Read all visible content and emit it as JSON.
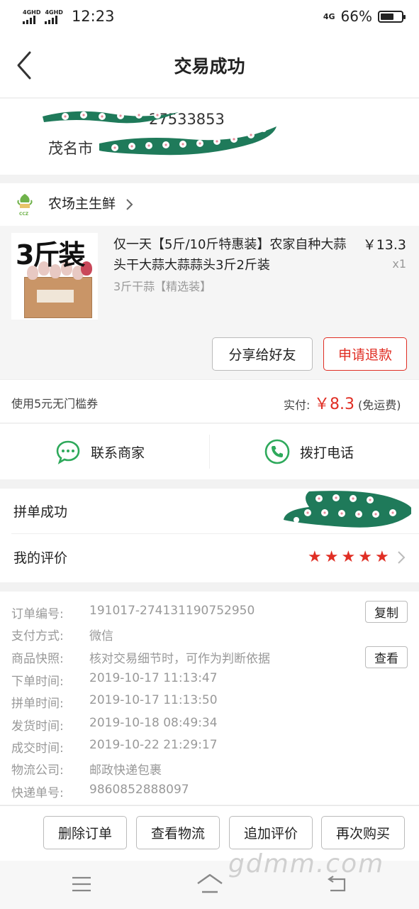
{
  "status_bar": {
    "sim1": "4GHD",
    "sim2": "4GHD",
    "time": "12:23",
    "network": "4G",
    "battery": "66%",
    "battery_level": 0.66
  },
  "header": {
    "title": "交易成功"
  },
  "address": {
    "phone_partial": "27533853",
    "city": "茂名市"
  },
  "shop": {
    "name": "农场主生鲜",
    "logo_text": "CCZ"
  },
  "product": {
    "image_text": "3斤装",
    "title": "仅一天【5斤/10斤特惠装】农家自种大蒜头干大蒜大蒜蒜头3斤2斤装",
    "spec": "3斤干蒜【精选装】",
    "price": "￥13.3",
    "qty": "x1"
  },
  "product_actions": {
    "share": "分享给好友",
    "refund": "申请退款"
  },
  "payment": {
    "coupon": "使用5元无门槛券",
    "paid_label": "实付:",
    "paid_amount": "￥8.3",
    "shipping_note": "(免运费)"
  },
  "contact": {
    "merchant": "联系商家",
    "call": "拨打电话"
  },
  "rows": {
    "group": "拼单成功",
    "review": "我的评价",
    "rating": 5
  },
  "order_info": {
    "items": [
      {
        "k": "订单编号:",
        "v": "191017-274131190752950"
      },
      {
        "k": "支付方式:",
        "v": "微信"
      },
      {
        "k": "商品快照:",
        "v": "核对交易细节时，可作为判断依据"
      },
      {
        "k": "下单时间:",
        "v": "2019-10-17 11:13:47"
      },
      {
        "k": "拼单时间:",
        "v": "2019-10-17 11:13:50"
      },
      {
        "k": "发货时间:",
        "v": "2019-10-18 08:49:34"
      },
      {
        "k": "成交时间:",
        "v": "2019-10-22 21:29:17"
      },
      {
        "k": "物流公司:",
        "v": "邮政快递包裹"
      },
      {
        "k": "快递单号:",
        "v": "9860852888097"
      }
    ],
    "copy": "复制",
    "view": "查看"
  },
  "bottom_actions": {
    "delete": "删除订单",
    "logistics": "查看物流",
    "add_review": "追加评价",
    "rebuy": "再次购买"
  },
  "watermark": "gdmm.com",
  "colors": {
    "accent": "#e02e24",
    "contact_green": "#2ea95b",
    "scribble_green": "#1f7a5a"
  }
}
